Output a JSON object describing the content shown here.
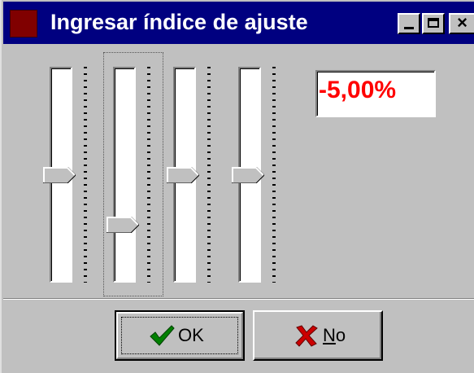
{
  "window": {
    "title": "Ingresar índice de ajuste",
    "icon": "app-icon",
    "controls": [
      "minimize-icon",
      "maximize-icon",
      "close-icon"
    ],
    "close_glyph": "×"
  },
  "sliders": [
    {
      "name": "slider-1",
      "level": 0.5
    },
    {
      "name": "slider-2",
      "level": 0.25
    },
    {
      "name": "slider-3",
      "level": 0.5
    },
    {
      "name": "slider-4",
      "level": 0.5
    }
  ],
  "value_display": {
    "text": "-5,00%",
    "color": "#ff0000"
  },
  "buttons": {
    "ok": {
      "label": "OK",
      "icon": "checkmark-icon",
      "icon_color": "#008000"
    },
    "no": {
      "label_first": "N",
      "label_rest": "o",
      "icon": "x-mark-icon",
      "icon_color": "#cc0000"
    }
  },
  "colors": {
    "titlebar": "#000080",
    "face": "#c0c0c0"
  }
}
